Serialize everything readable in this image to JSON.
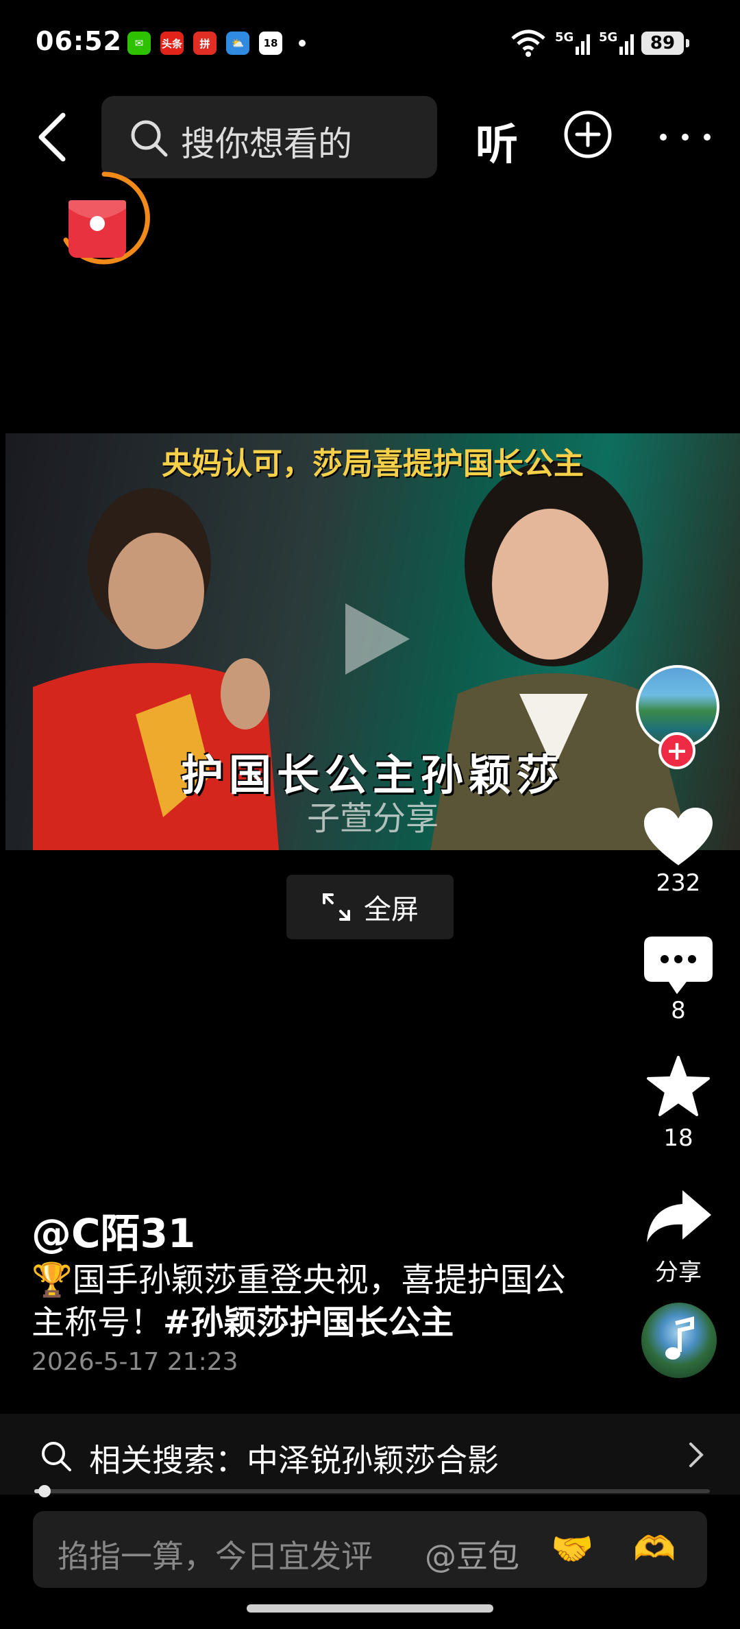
{
  "status_bar": {
    "time": "06:52",
    "apps": [
      {
        "icon": "wechat-icon",
        "glyph": "✉",
        "color": "#2dc100"
      },
      {
        "icon": "toutiao-icon",
        "glyph": "头条",
        "color": "#e2231a"
      },
      {
        "icon": "pinduoduo-icon",
        "glyph": "拼",
        "color": "#e02e24"
      },
      {
        "icon": "weather-icon",
        "glyph": "⛅",
        "color": "#2f8ae0"
      },
      {
        "icon": "calendar-icon",
        "glyph": "18",
        "color": "#ffffff"
      }
    ],
    "signal_1": "5G",
    "signal_2": "5G",
    "battery": "89"
  },
  "top_nav": {
    "search_placeholder": "搜你想看的",
    "listen_label": "听"
  },
  "video": {
    "top_caption": "央妈认可，莎局喜提护国长公主",
    "main_caption": "护国长公主孙颖莎",
    "watermark": "子萱分享"
  },
  "fullscreen": {
    "label": "全屏"
  },
  "side_rail": {
    "like_count": "232",
    "comment_count": "8",
    "favorite_count": "18",
    "share_label": "分享"
  },
  "post": {
    "author": "@C陌31",
    "description_emoji": "🏆",
    "description": "国手孙颖莎重登央视，喜提护国公主称号！",
    "hashtag": "#孙颖莎护国长公主",
    "date": "2026-5-17 21:23"
  },
  "related_search": {
    "label": "相关搜索：中泽锐孙颖莎合影"
  },
  "progress": {
    "fraction": 0.01
  },
  "comment_bar": {
    "placeholder": "掐指一算，今日宜发评",
    "mention": "@豆包",
    "emoji_1": "🤝",
    "emoji_2": "🫶"
  },
  "colors": {
    "accent_red": "#ee2a45",
    "redpacket_ring": "#f28a1a"
  }
}
